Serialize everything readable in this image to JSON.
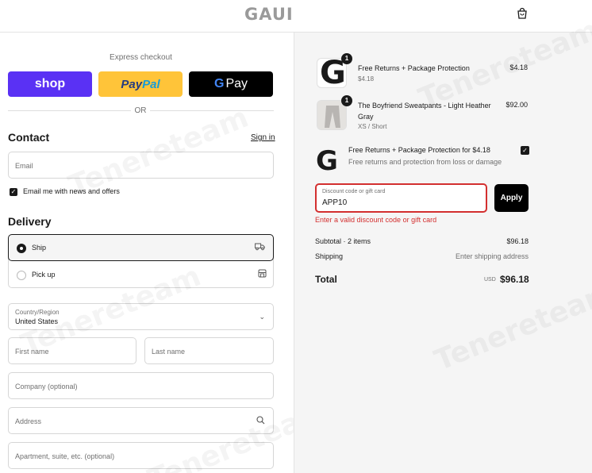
{
  "header": {
    "logo": "GAUI",
    "cart_icon": "shopping-bag-icon"
  },
  "express": {
    "label": "Express checkout",
    "shop_label": "shop",
    "paypal_part1": "Pay",
    "paypal_part2": "Pal",
    "gpay_g": "G",
    "gpay_label": "Pay",
    "or": "OR"
  },
  "contact": {
    "heading": "Contact",
    "sign_in": "Sign in",
    "email_placeholder": "Email",
    "newsletter_label": "Email me with news and offers",
    "newsletter_checked": true
  },
  "delivery": {
    "heading": "Delivery",
    "options": [
      {
        "label": "Ship",
        "icon": "truck-icon",
        "selected": true
      },
      {
        "label": "Pick up",
        "icon": "store-icon",
        "selected": false
      }
    ],
    "country_label": "Country/Region",
    "country_value": "United States",
    "first_name": "First name",
    "last_name": "Last name",
    "company": "Company (optional)",
    "address": "Address",
    "apartment": "Apartment, suite, etc. (optional)"
  },
  "order": {
    "items": [
      {
        "name": "Free Returns + Package Protection",
        "sub": "$4.18",
        "price": "$4.18",
        "qty": "1"
      },
      {
        "name": "The Boyfriend Sweatpants - Light Heather Gray",
        "sub": "XS / Short",
        "price": "$92.00",
        "qty": "1"
      }
    ],
    "protection": {
      "logo": "G",
      "title": "Free Returns + Package Protection for $4.18",
      "subtitle": "Free returns and protection from loss or damage",
      "checked": true
    },
    "discount": {
      "label": "Discount code or gift card",
      "value": "APP10",
      "apply": "Apply",
      "error": "Enter a valid discount code or gift card"
    },
    "subtotal_label": "Subtotal · 2 items",
    "subtotal_value": "$96.18",
    "shipping_label": "Shipping",
    "shipping_value": "Enter shipping address",
    "total_label": "Total",
    "total_currency": "USD",
    "total_value": "$96.18"
  },
  "watermark": "Tenereteam",
  "colors": {
    "shop": "#5a31f4",
    "paypal": "#ffc439",
    "error": "#d32f2f",
    "panel": "#f5f5f5"
  }
}
